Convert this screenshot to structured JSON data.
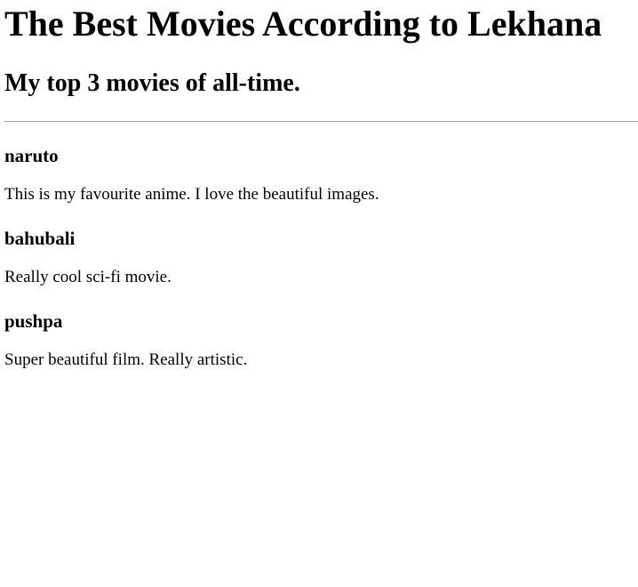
{
  "page": {
    "title": "The Best Movies According to Lekhana",
    "subtitle": "My top 3 movies of all-time."
  },
  "movies": [
    {
      "name": "naruto",
      "description": "This is my favourite anime. I love the beautiful images."
    },
    {
      "name": "bahubali",
      "description": "Really cool sci-fi movie."
    },
    {
      "name": "pushpa",
      "description": "Super beautiful film. Really artistic."
    }
  ]
}
